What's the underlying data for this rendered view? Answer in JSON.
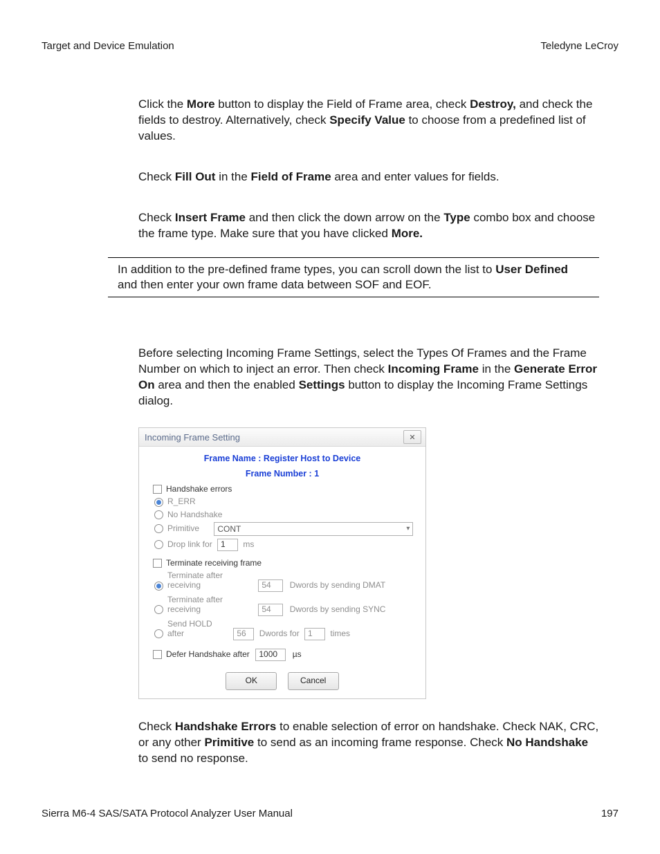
{
  "header": {
    "left": "Target and Device Emulation",
    "right": "Teledyne LeCroy"
  },
  "footer": {
    "left": "Sierra M6-4 SAS/SATA Protocol Analyzer User Manual",
    "right": "197"
  },
  "p1": {
    "a": "Click the ",
    "b": "More",
    "c": " button to display the Field of Frame area, check ",
    "d": "Destroy,",
    "e": " and check the fields to destroy. Alternatively, check ",
    "f": "Specify Value",
    "g": " to choose from a predefined list of values."
  },
  "p2": {
    "a": "Check ",
    "b": "Fill Out",
    "c": " in the ",
    "d": "Field of Frame",
    "e": " area and enter values for fields."
  },
  "p3": {
    "a": "Check ",
    "b": "Insert Frame",
    "c": " and then click the down arrow on the ",
    "d": "Type",
    "e": " combo box and choose the frame type. Make sure that you have clicked ",
    "f": "More."
  },
  "note": {
    "a": "In addition to the pre-defined frame types, you can scroll down the list to ",
    "b": "User Defined",
    "c": " and then enter your own frame data between SOF and EOF."
  },
  "p4": {
    "a": "Before selecting Incoming Frame Settings, select the Types Of Frames and the Frame Number on which to inject an error. Then check ",
    "b": "Incoming Frame",
    "c": " in the ",
    "d": "Generate Error On",
    "e": " area and then the enabled ",
    "f": "Settings",
    "g": " button to display the Incoming Frame Settings dialog."
  },
  "dialog": {
    "title": "Incoming Frame Setting",
    "h1": "Frame Name : Register Host to Device",
    "h2": "Frame Number : 1",
    "handshake_label": "Handshake errors",
    "r_err": "R_ERR",
    "no_handshake": "No Handshake",
    "primitive": "Primitive",
    "primitive_value": "CONT",
    "drop_a": "Drop link for",
    "drop_val": "1",
    "drop_b": "ms",
    "term_label": "Terminate receiving frame",
    "t1_a": "Terminate after receiving",
    "t1_val": "54",
    "t1_b": "Dwords by sending DMAT",
    "t2_a": "Terminate after receiving",
    "t2_val": "54",
    "t2_b": "Dwords by sending SYNC",
    "t3_a": "Send HOLD after",
    "t3_val1": "56",
    "t3_b": "Dwords for",
    "t3_val2": "1",
    "t3_c": "times",
    "defer_a": "Defer Handshake after",
    "defer_val": "1000",
    "defer_b": "µs",
    "ok": "OK",
    "cancel": "Cancel"
  },
  "p5": {
    "a": "Check ",
    "b": "Handshake Errors",
    "c": " to enable selection of error on handshake. Check NAK, CRC, or any other ",
    "d": "Primitive",
    "e": " to send as an incoming frame response. Check ",
    "f": "No Handshake",
    "g": " to send no response."
  }
}
